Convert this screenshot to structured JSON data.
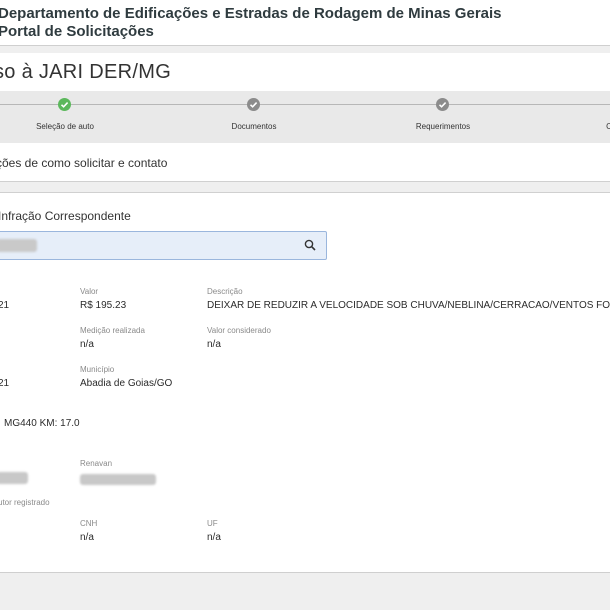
{
  "header": {
    "line1": "Departamento de Edificações e Estradas de Rodagem de Minas Gerais",
    "line2": "Portal de Solicitações"
  },
  "page_title": "so à JARI DER/MG",
  "stepper": {
    "steps": [
      {
        "label": "Seleção de auto",
        "state": "done"
      },
      {
        "label": "Documentos",
        "state": "pending"
      },
      {
        "label": "Requerimentos",
        "state": "pending"
      },
      {
        "label": "C",
        "state": "pending"
      }
    ],
    "active_color": "#5cb85c",
    "pending_color": "#8c8c8c"
  },
  "info_bar": {
    "text": "ções de como solicitar e contato"
  },
  "infraction": {
    "section_title": "Infração Correspondente",
    "search_icon": "search-icon",
    "row1": {
      "left_value": "21",
      "valor_label": "Valor",
      "valor_value": "R$ 195.23",
      "descricao_label": "Descrição",
      "descricao_value": "DEIXAR DE REDUZIR A VELOCIDADE SOB CHUVA/NEBLINA/CERRACAO/VENTOS FORTES"
    },
    "row2": {
      "medicao_label": "Medição realizada",
      "medicao_value": "n/a",
      "considerado_label": "Valor considerado",
      "considerado_value": "n/a"
    },
    "row3": {
      "left_value": "21",
      "municipio_label": "Município",
      "municipio_value": "Abadia de Goias/GO"
    },
    "local": "MG440 KM: 17.0",
    "row5": {
      "renavan_label": "Renavan"
    },
    "condutor_label": "utor registrado",
    "row6": {
      "cnh_label": "CNH",
      "cnh_value": "n/a",
      "uf_label": "UF",
      "uf_value": "n/a"
    }
  }
}
